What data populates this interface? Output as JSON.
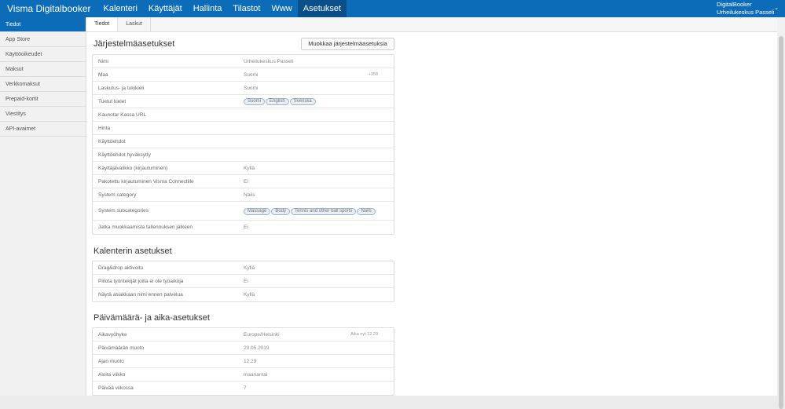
{
  "nav": {
    "brand": "Visma Digitalbooker",
    "items": [
      "Kalenteri",
      "Käyttäjät",
      "Hallinta",
      "Tilastot",
      "Www",
      "Asetukset"
    ]
  },
  "user": {
    "name": "DigitalBooker",
    "company": "Urheilukeskus Passeli"
  },
  "sidebar": {
    "items": [
      "Tiedot",
      "App Store",
      "Käyttöoikeudet",
      "Maksut",
      "Verkkomaksut",
      "Prepaid-kortit",
      "Viestitys",
      "API-avaimet"
    ]
  },
  "tabs": [
    "Tiedot",
    "Laskut"
  ],
  "system": {
    "title": "Järjestelmäasetukset",
    "edit_label": "Muokkaa järjestelmäasetuksia",
    "rows": [
      {
        "label": "Nimi",
        "value": "Urheilukeskus Passeli"
      },
      {
        "label": "Maa",
        "value": "Suomi",
        "extra": "+358"
      },
      {
        "label": "Laskutus- ja tukikieli",
        "value": "Suomi"
      },
      {
        "label": "Tuetut kielet",
        "chips": [
          "Suomi",
          "English",
          "Svenska"
        ]
      },
      {
        "label": "Kaunotar Kassa URL",
        "value": ""
      },
      {
        "label": "Hinta",
        "value": ""
      },
      {
        "label": "Käyttöehdot",
        "value": ""
      },
      {
        "label": "Käyttöehdot hyväksytty",
        "value": ""
      },
      {
        "label": "Käyttäjävalikko (kirjautuminen)",
        "value": "Kyllä"
      },
      {
        "label": "Pakotettu kirjautuminen Visma Connectille",
        "value": "Ei"
      },
      {
        "label": "System category",
        "value": "Nails"
      },
      {
        "label": "System subcategories",
        "chips": [
          "Massage",
          "Body",
          "Tennis and other ball sports",
          "Nails"
        ]
      },
      {
        "label": "Jatka muokkaamista tallennuksen jälkeen",
        "value": "Ei"
      }
    ]
  },
  "calendar": {
    "title": "Kalenterin asetukset",
    "rows": [
      {
        "label": "Drag&drop aktivoitu",
        "value": "Kyllä"
      },
      {
        "label": "Piilota työntekijät joilla ei ole työaikoja",
        "value": "Ei"
      },
      {
        "label": "Näytä asiakkaan nimi ennen palvelua",
        "value": "Kyllä"
      }
    ]
  },
  "datetime": {
    "title": "Päivämäärä- ja aika-asetukset",
    "rows": [
      {
        "label": "Aikavyöhyke",
        "value": "Europe/Helsinki",
        "extra": "Aika nyt 12.29"
      },
      {
        "label": "Päivämäärän muoto",
        "value": "20.05.2019"
      },
      {
        "label": "Ajan muoto",
        "value": "12.29"
      },
      {
        "label": "Aloita viikko",
        "value": "maanantai"
      },
      {
        "label": "Päivää viikossa",
        "value": "7"
      }
    ]
  }
}
